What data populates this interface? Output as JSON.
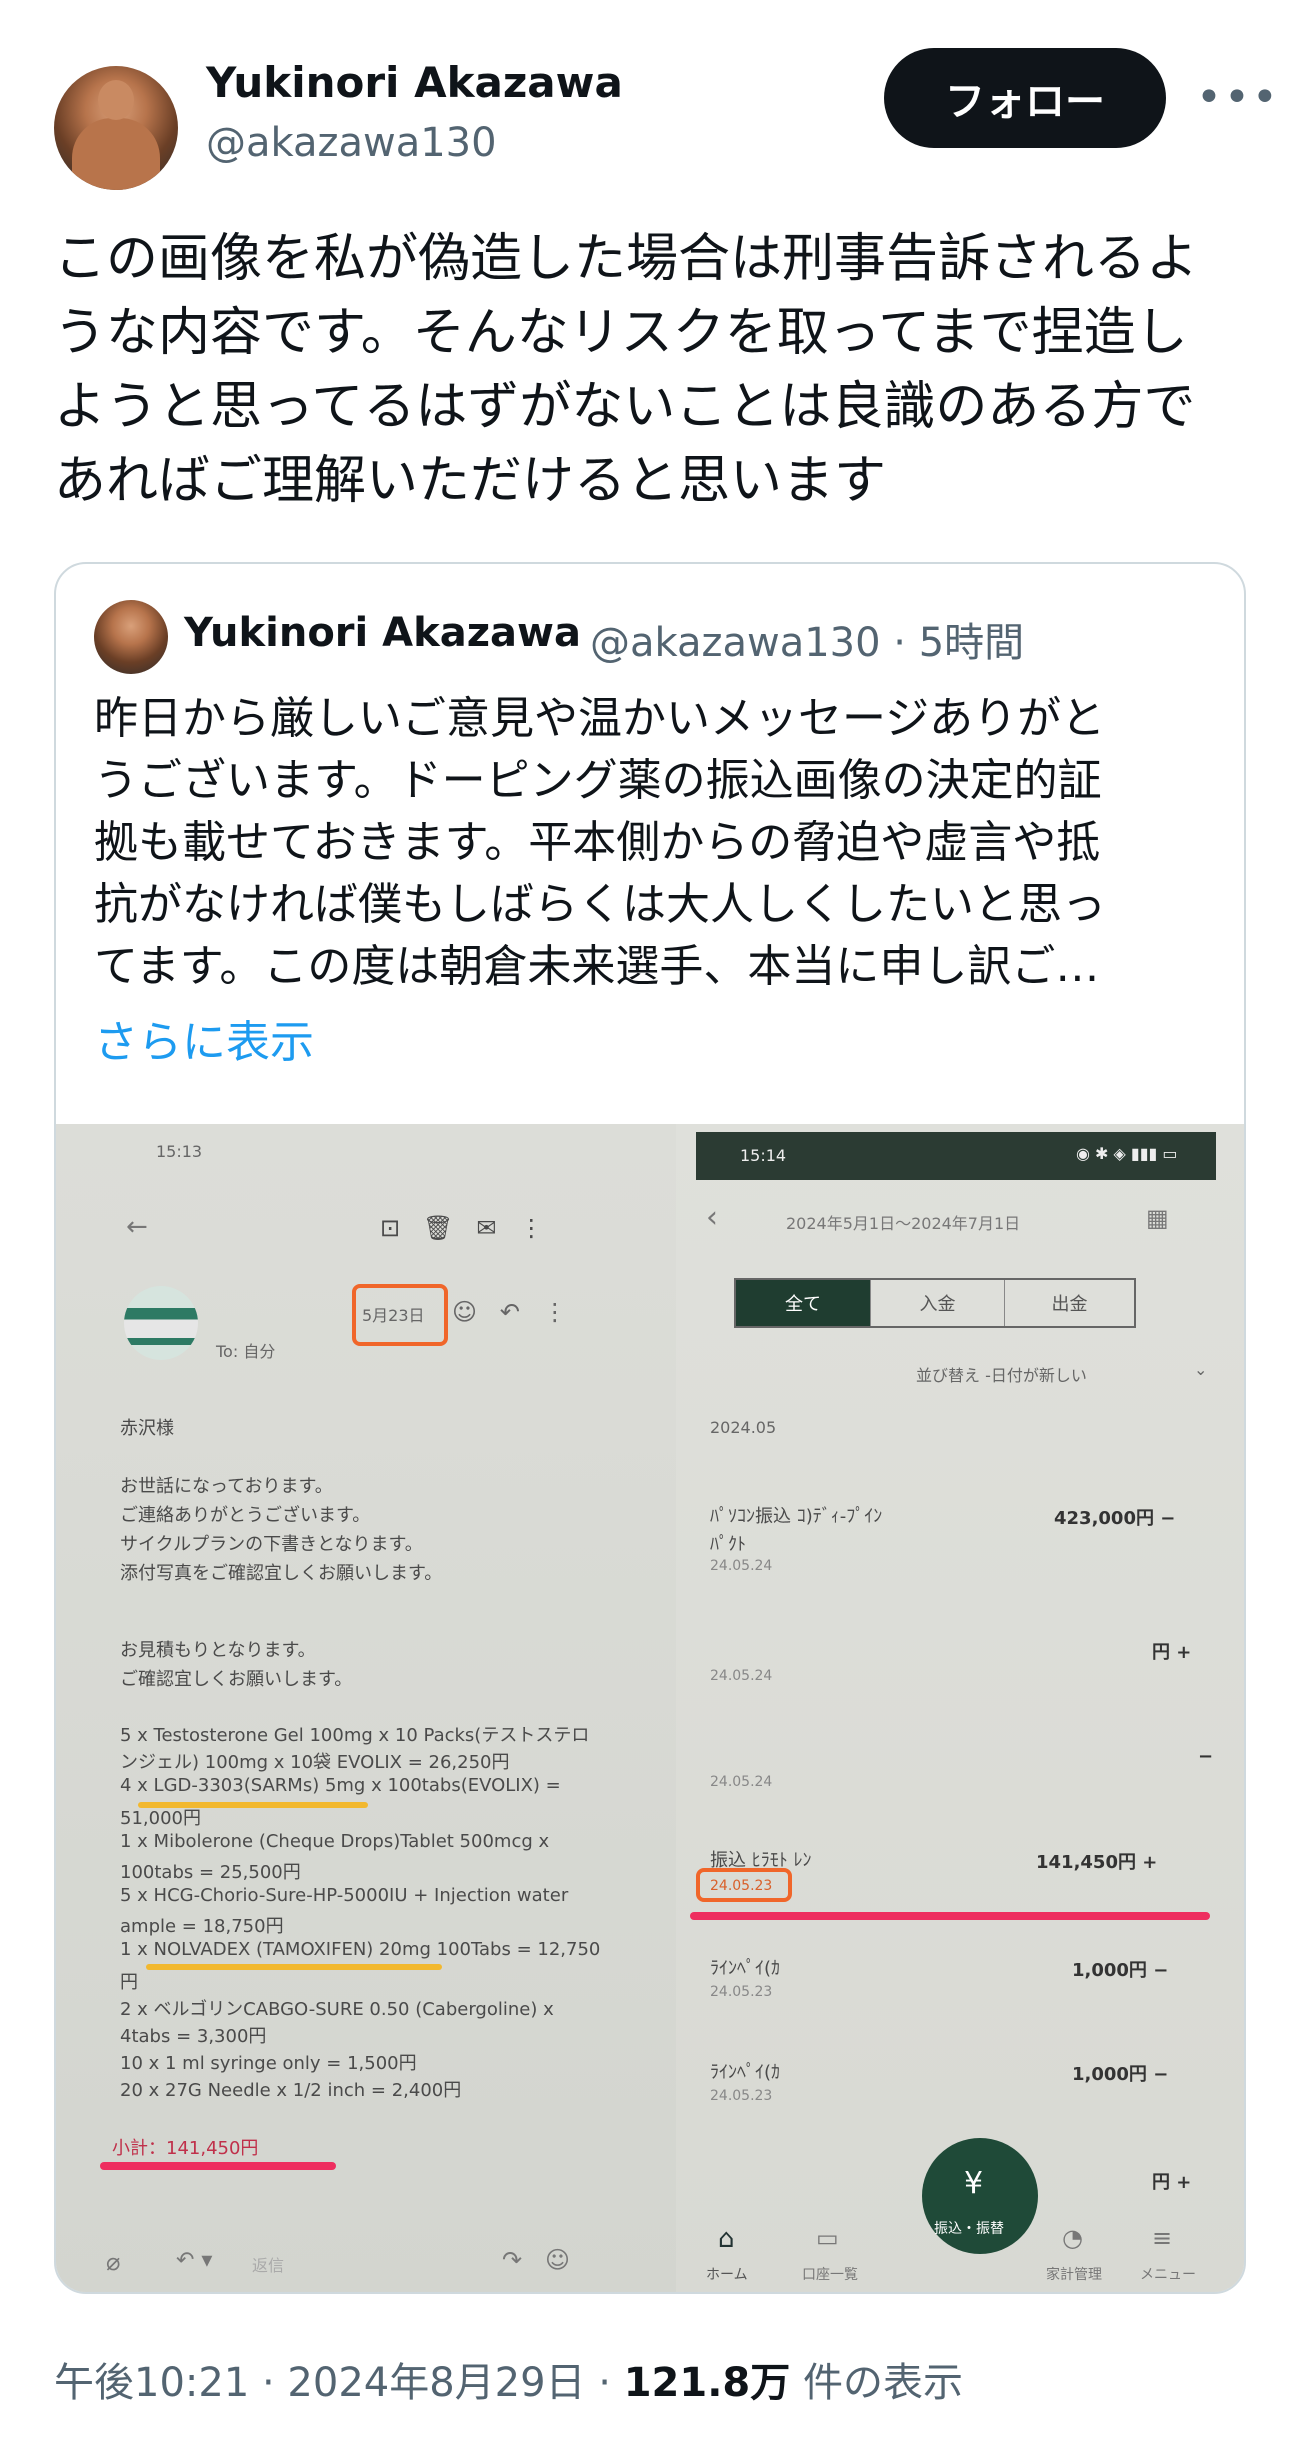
{
  "header": {
    "display_name": "Yukinori Akazawa",
    "handle": "@akazawa130",
    "follow_label": "フォロー",
    "more_label": "•••"
  },
  "tweet": {
    "lines": [
      "この画像を私が偽造した場合は刑事告訴されるよ",
      "うな内容です。そんなリスクを取ってまで捏造し",
      "ようと思ってるはずがないことは良識のある方で",
      "あればご理解いただけると思います"
    ]
  },
  "quote": {
    "display_name": "Yukinori Akazawa",
    "handle_time": "@akazawa130 · 5時間",
    "lines": [
      "昨日から厳しいご意見や温かいメッセージありがと",
      "うございます。ドーピング薬の振込画像の決定的証",
      "拠も載せておきます。平本側からの脅迫や虚言や抵",
      "抗がなければ僕もしばらくは大人しくしたいと思っ",
      "てます。この度は朝倉未来選手、本当に申し訳ご…"
    ],
    "show_more": "さらに表示"
  },
  "photo_left": {
    "time": "15:13",
    "date_badge": "5月23日",
    "to": "To: 自分",
    "lines": [
      "赤沢様",
      "お世話になっております。",
      "ご連絡ありがとうございます。",
      "サイクルプランの下書きとなります。",
      "添付写真をご確認宜しくお願いします。",
      "お見積もりとなります。",
      "ご確認宜しくお願いします。",
      "5 x Testosterone Gel 100mg x 10 Packs(テストステロ",
      "ンジェル) 100mg x 10袋 EVOLIX = 26,250円",
      "4 x LGD-3303(SARMs) 5mg x 100tabs(EVOLIX) =",
      "51,000円",
      "1 x Mibolerone (Cheque Drops)Tablet 500mcg x",
      "100tabs = 25,500円",
      "5 x HCG-Chorio-Sure-HP-5000IU + Injection water",
      "ample = 18,750円",
      "1 x NOLVADEX (TAMOXIFEN) 20mg 100Tabs = 12,750",
      "円",
      "2 x ベルゴリンCABGO-SURE 0.50 (Cabergoline) x",
      "4tabs = 3,300円",
      "10 x 1 ml syringe only = 1,500円",
      "20 x 27G Needle x 1/2 inch = 2,400円"
    ],
    "subtotal": "小計：141,450円",
    "reply": "返信"
  },
  "photo_right": {
    "time": "15:14",
    "range": "2024年5月1日～2024年7月1日",
    "tabs": [
      "全て",
      "入金",
      "出金"
    ],
    "sort": "並び替え  -日付が新しい",
    "month": "2024.05",
    "entries": [
      {
        "name": "ﾊﾟｿｺﾝ振込 ｺ)ﾃﾞｨ-ﾌﾟｲﾝ",
        "name2": "ﾊﾟｸﾄ",
        "date": "24.05.24",
        "amount": "423,000円 −"
      },
      {
        "name": "",
        "date": "24.05.24",
        "amount": "円 +"
      },
      {
        "name": "",
        "date": "24.05.24",
        "amount": "−"
      },
      {
        "name": "振込  ﾋﾗﾓﾄ ﾚﾝ",
        "date": "24.05.23",
        "amount": "141,450円 +"
      },
      {
        "name": "ﾗｲﾝﾍﾟｲ(ｶ",
        "date": "24.05.23",
        "amount": "1,000円 −"
      },
      {
        "name": "ﾗｲﾝﾍﾟｲ(ｶ",
        "date": "24.05.23",
        "amount": "1,000円 −"
      },
      {
        "name": "",
        "date": "",
        "amount": "円 +"
      }
    ],
    "nav": [
      "ホーム",
      "口座一覧",
      "振込・振替",
      "家計管理",
      "メニュー"
    ]
  },
  "footer": {
    "time_date": "午後10:21 · 2024年8月29日 · ",
    "views": "121.8万",
    "views_label": " 件の表示"
  }
}
